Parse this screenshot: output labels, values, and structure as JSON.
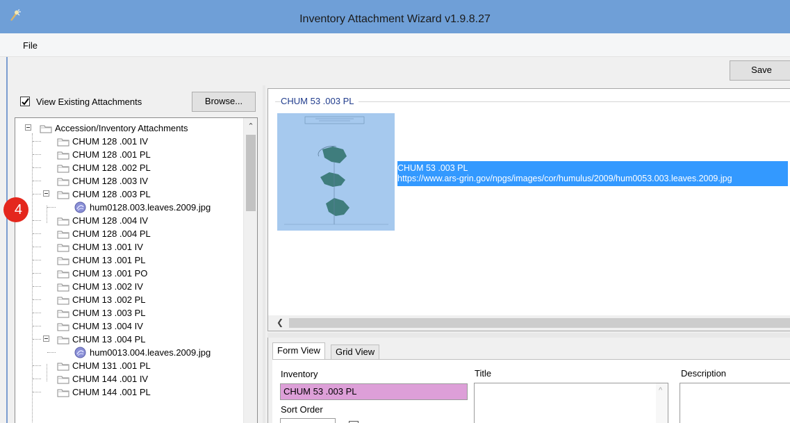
{
  "window": {
    "title": "Inventory Attachment Wizard v1.9.8.27",
    "icon": "wizard-app-icon"
  },
  "menu": {
    "items": [
      "File"
    ]
  },
  "toolbar": {
    "save_label": "Save"
  },
  "left_pane": {
    "view_existing_label": "View Existing Attachments",
    "view_existing_checked": true,
    "browse_label": "Browse...",
    "step_badge": "4",
    "tree": {
      "root": "Accession/Inventory Attachments",
      "nodes": [
        "CHUM 128 .001 IV",
        "CHUM 128 .001 PL",
        "CHUM 128 .002 PL",
        "CHUM 128 .003 IV",
        "CHUM 128 .003 PL",
        "hum0128.003.leaves.2009.jpg",
        "CHUM 128 .004 IV",
        "CHUM 128 .004 PL",
        "CHUM 13 .001 IV",
        "CHUM 13 .001 PL",
        "CHUM 13 .001 PO",
        "CHUM 13 .002 IV",
        "CHUM 13 .002 PL",
        "CHUM 13 .003 PL",
        "CHUM 13 .004 IV",
        "CHUM 13 .004 PL",
        "hum0013.004.leaves.2009.jpg",
        "CHUM 131 .001 PL",
        "CHUM 144 .001 IV",
        "CHUM 144 .001 PL"
      ]
    }
  },
  "preview": {
    "group_title": "CHUM 53 .003 PL",
    "selected_item": {
      "line1": "CHUM 53 .003 PL",
      "line2": "https://www.ars-grin.gov/npgs/images/cor/humulus/2009/hum0053.003.leaves.2009.jpg"
    }
  },
  "form": {
    "tabs": [
      "Form View",
      "Grid View"
    ],
    "inventory_label": "Inventory",
    "inventory_value": "CHUM 53 .003 PL",
    "title_label": "Title",
    "description_label": "Description",
    "sort_order_label": "Sort Order"
  }
}
